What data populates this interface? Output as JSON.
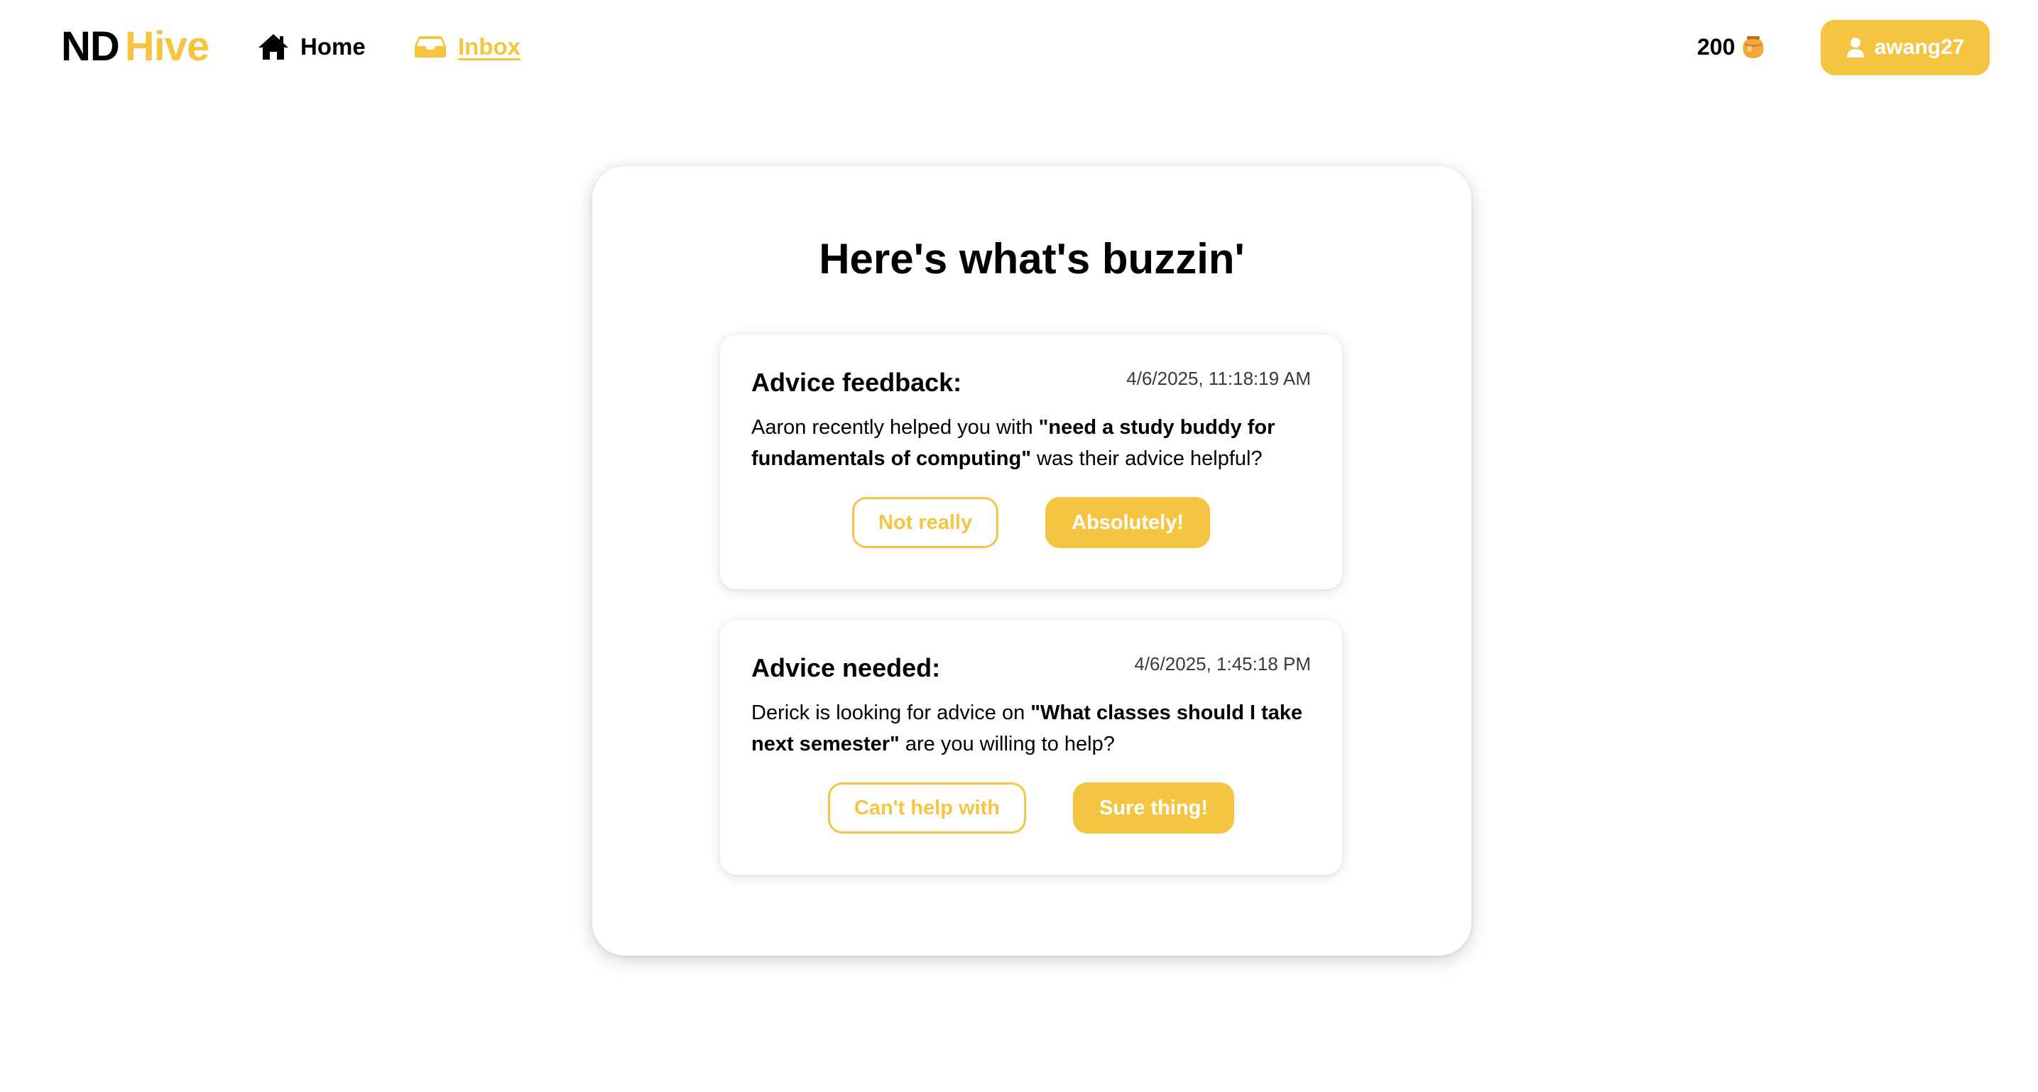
{
  "brand": {
    "part1": "ND",
    "part2": "Hive",
    "accent_color": "#f5c542"
  },
  "nav": {
    "home_label": "Home",
    "home_icon": "home-icon",
    "inbox_label": "Inbox",
    "inbox_icon": "inbox-tray-icon"
  },
  "account": {
    "coin_balance": "200",
    "coin_icon": "honey-pot-icon",
    "username": "awang27",
    "user_icon": "user-icon"
  },
  "inbox": {
    "title": "Here's what's buzzin'",
    "notifications": [
      {
        "heading": "Advice feedback:",
        "timestamp": "4/6/2025, 11:18:19 AM",
        "text_before": "Aaron recently helped you with ",
        "text_bold": "\"need a study buddy for fundamentals of computing\"",
        "text_after": " was their advice helpful?",
        "secondary_label": "Not really",
        "primary_label": "Absolutely!"
      },
      {
        "heading": "Advice needed:",
        "timestamp": "4/6/2025, 1:45:18 PM",
        "text_before": "Derick is looking for advice on ",
        "text_bold": "\"What classes should I take next semester\"",
        "text_after": " are you willing to help?",
        "secondary_label": "Can't help with",
        "primary_label": "Sure thing!"
      }
    ]
  }
}
